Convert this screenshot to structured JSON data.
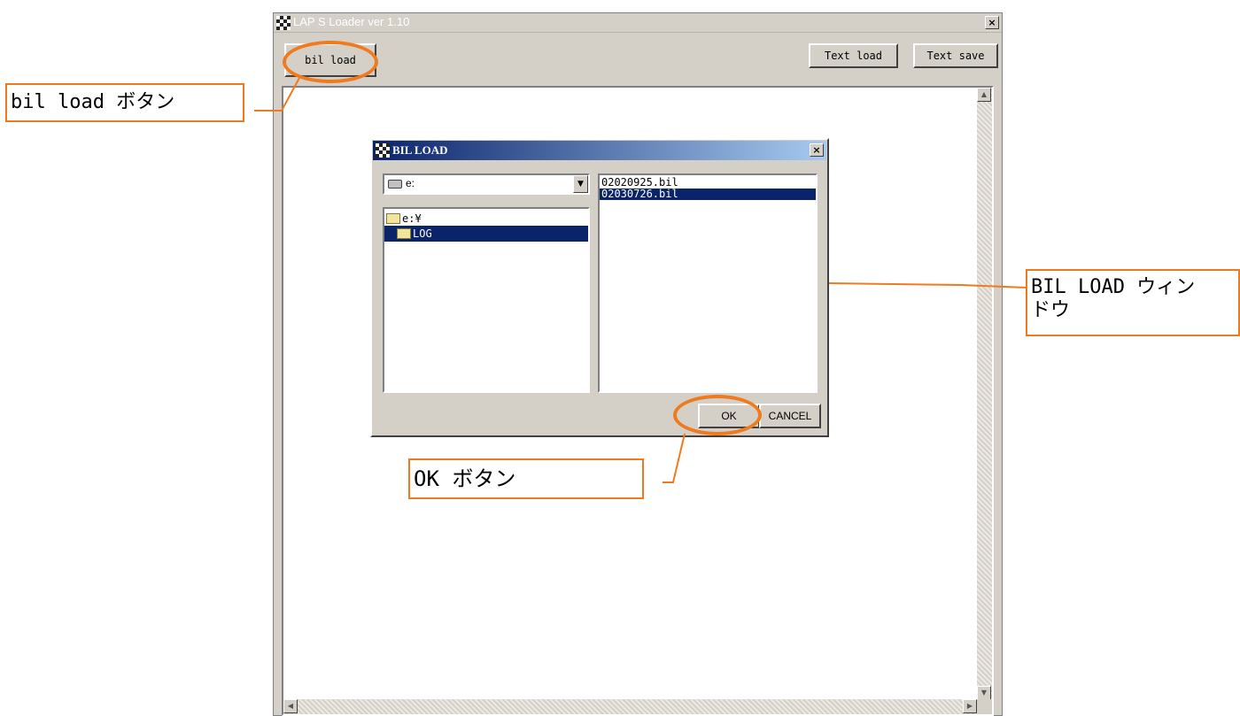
{
  "main_window": {
    "title": "LAP S Loader  ver 1.10",
    "close_glyph": "×",
    "bil_load_label": "bil load",
    "text_load_label": "Text load",
    "text_save_label": "Text save"
  },
  "dialog": {
    "title": "BIL LOAD",
    "close_glyph": "×",
    "drive_value": "e:",
    "tree_items": [
      "e:¥",
      "LOG"
    ],
    "selected_tree_item": "LOG",
    "files": [
      "02020925.bil",
      "02030726.bil"
    ],
    "selected_file": "02030726.bil",
    "ok_label": "OK",
    "cancel_label": "CANCEL"
  },
  "annotations": {
    "bil_load_callout": "bil load ボタン",
    "dialog_callout_line1": "BIL LOAD ウィン",
    "dialog_callout_line2": "ドウ",
    "ok_callout": "OK ボタン",
    "accent_color": "#f07a1e"
  },
  "icons": [
    "app-checker-icon",
    "drive-icon",
    "folder-icon",
    "close-icon",
    "dropdown-arrow-icon",
    "scroll-arrow-icon"
  ]
}
